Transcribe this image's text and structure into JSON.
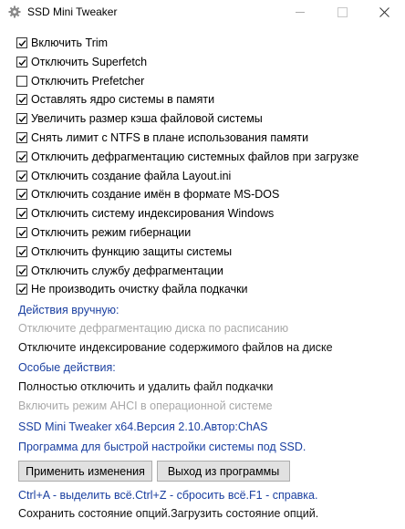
{
  "window": {
    "title": "SSD Mini Tweaker",
    "icon": "gear-app-icon",
    "controls": [
      "minimize-icon",
      "maximize-icon",
      "close-icon"
    ]
  },
  "options": [
    {
      "label": "Включить Trim",
      "checked": true
    },
    {
      "label": "Отключить Superfetch",
      "checked": true
    },
    {
      "label": "Отключить Prefetcher",
      "checked": false
    },
    {
      "label": "Оставлять ядро системы в памяти",
      "checked": true
    },
    {
      "label": "Увеличить размер кэша файловой системы",
      "checked": true
    },
    {
      "label": "Снять лимит с NTFS в плане использования памяти",
      "checked": true
    },
    {
      "label": "Отключить дефрагментацию системных файлов при загрузке",
      "checked": true
    },
    {
      "label": "Отключить создание файла Layout.ini",
      "checked": true
    },
    {
      "label": "Отключить создание имён в формате MS-DOS",
      "checked": true
    },
    {
      "label": "Отключить систему индексирования Windows",
      "checked": true
    },
    {
      "label": "Отключить режим гибернации",
      "checked": true
    },
    {
      "label": "Отключить функцию защиты системы",
      "checked": true
    },
    {
      "label": "Отключить службу дефрагментации",
      "checked": true
    },
    {
      "label": "Не производить очистку файла подкачки",
      "checked": true
    }
  ],
  "manual": {
    "heading": "Действия вручную:",
    "item1": "Отключите дефрагментацию диска по расписанию",
    "item2": "Отключите индексирование содержимого файлов на диске"
  },
  "special": {
    "heading": "Особые действия:",
    "item1": "Полностью отключить и удалить файл подкачки",
    "item2": "Включить режим AHCI в операционной системе"
  },
  "about": {
    "version": "SSD Mini Tweaker x64.Версия 2.10.Автор:ChAS",
    "description": "Программа для быстрой настройки системы под SSD."
  },
  "buttons": {
    "apply": "Применить изменения",
    "exit": "Выход из программы"
  },
  "footer": {
    "hotkeys": "Ctrl+A - выделить всё.Ctrl+Z - сбросить всё.F1 - справка.",
    "state": "Сохранить состояние опций.Загрузить состояние опций."
  },
  "colors": {
    "link_blue": "#1a3fa0",
    "disabled_gray": "#a9a9a9",
    "button_face": "#e1e1e1"
  }
}
